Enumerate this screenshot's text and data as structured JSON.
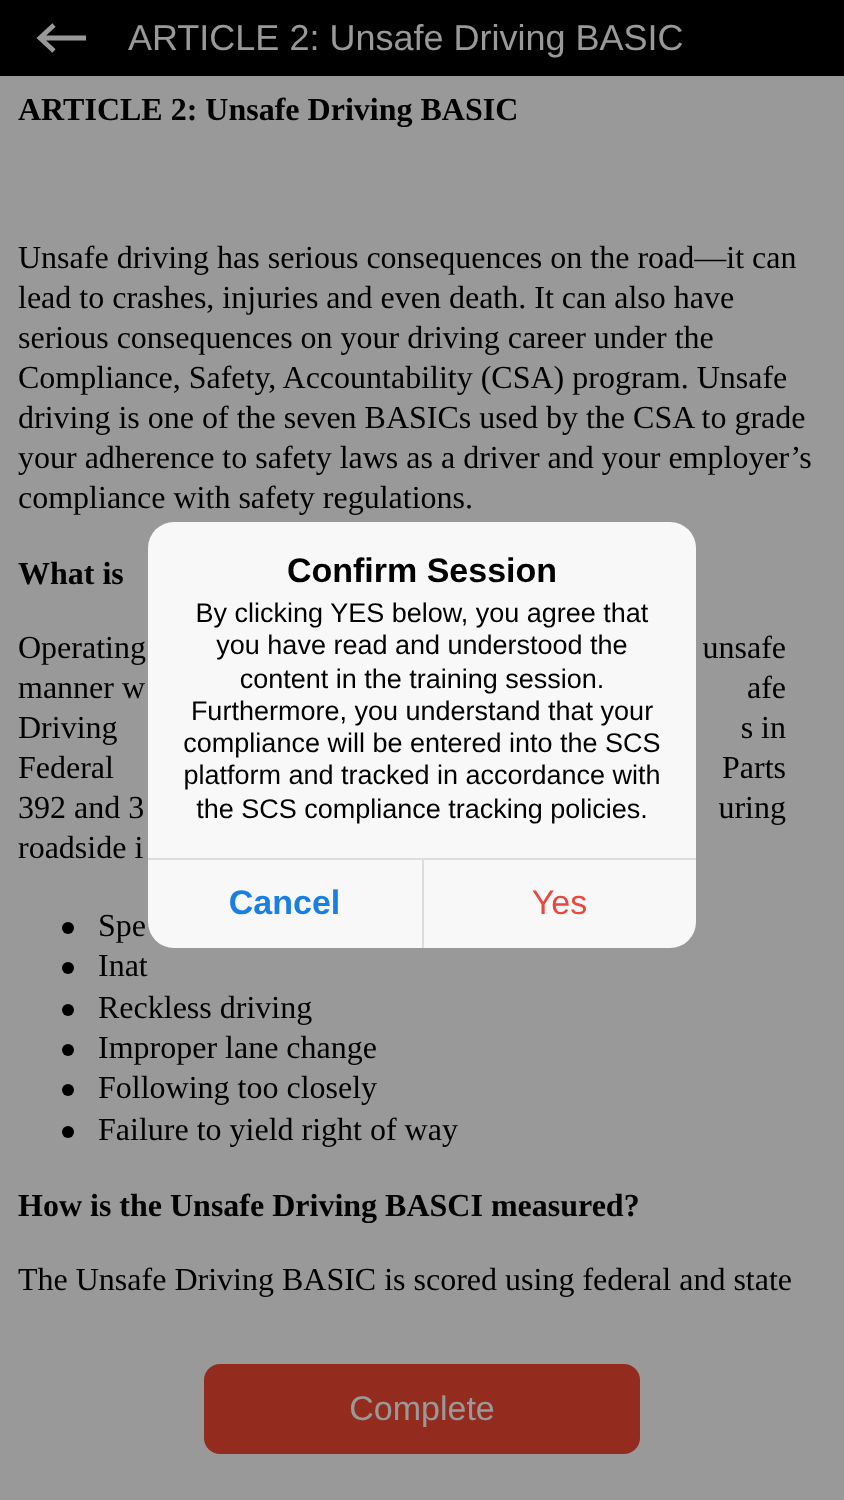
{
  "header": {
    "title": "ARTICLE 2: Unsafe Driving BASIC"
  },
  "article": [
    {
      "kind": "title",
      "text": "ARTICLE 2: Unsafe Driving BASIC"
    },
    {
      "kind": "paragraph",
      "text": "Unsafe driving has serious consequences on the road—it can lead to crashes, injuries and even death. It can also have serious consequences on your driving career under the Compliance, Safety, Accountability (CSA) program. Unsafe driving is one of the seven BASICs used by the CSA to grade your adherence to safety laws as a driver and your employer’s compliance with safety regulations."
    },
    {
      "kind": "heading",
      "text": "What is"
    },
    {
      "kind": "split_lines",
      "lines": [
        {
          "left": "Operating",
          "right": "unsafe"
        },
        {
          "left": "manner w",
          "right": "afe"
        },
        {
          "left": "Driving",
          "right": "s in"
        },
        {
          "left": "Federal",
          "right": "Parts"
        },
        {
          "left": "392 and 3",
          "right": "uring"
        },
        {
          "left": "roadside i"
        }
      ]
    },
    {
      "kind": "bullets",
      "items": [
        "Spe",
        "Inat",
        "Reckless driving",
        "Improper lane change",
        "Following too closely",
        "Failure to yield right of way"
      ]
    },
    {
      "kind": "heading",
      "text": "How is the Unsafe Driving BASCI measured?"
    },
    {
      "kind": "paragraph",
      "text": "The Unsafe Driving BASIC is scored using federal and state"
    }
  ],
  "complete_button": "Complete",
  "dialog": {
    "title": "Confirm Session",
    "message": "By clicking YES below, you agree that you have read and understood the content in the training session. Furthermore, you understand that your compliance will be entered into the SCS platform and tracked in accordance with the SCS compliance tracking policies.",
    "cancel": "Cancel",
    "confirm": "Yes"
  }
}
